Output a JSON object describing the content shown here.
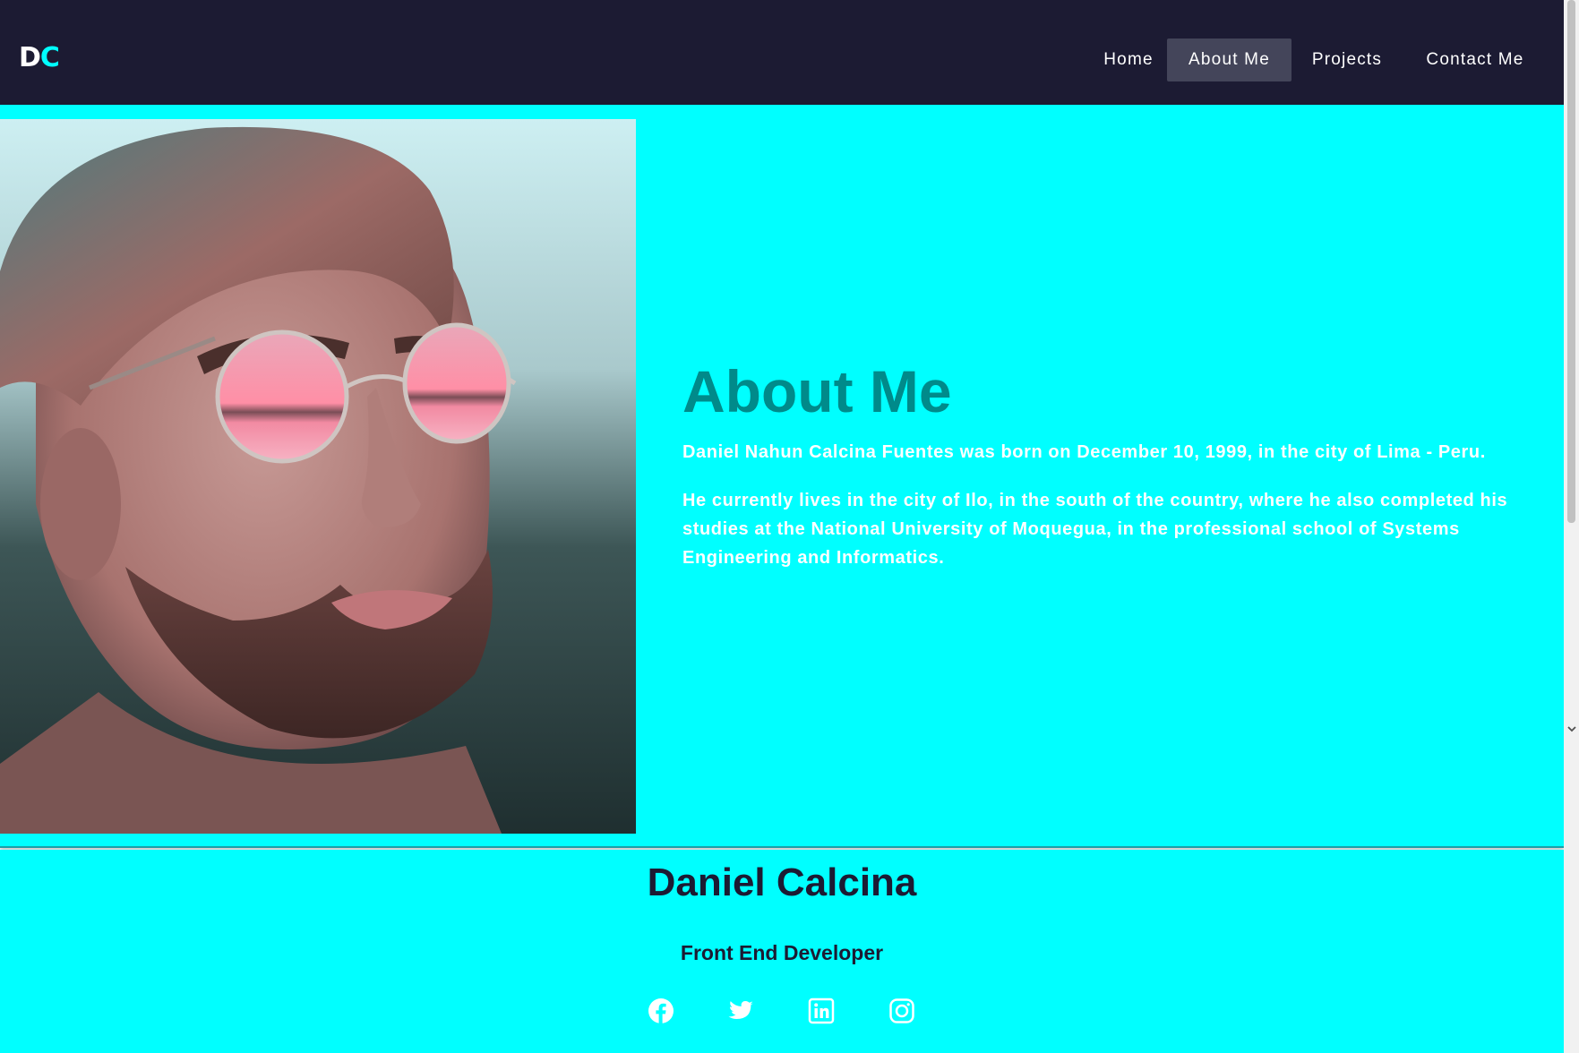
{
  "logo": {
    "part1": "D",
    "part2": "C"
  },
  "nav": {
    "items": [
      {
        "label": "Home"
      },
      {
        "label": "About Me",
        "active": true
      },
      {
        "label": "Projects"
      },
      {
        "label": "Contact Me"
      }
    ]
  },
  "hero": {
    "photo_alt": "portrait-photo",
    "title": "About Me",
    "paragraph1": "Daniel Nahun Calcina Fuentes was born on December 10, 1999, in the city of Lima - Peru.",
    "paragraph2": "He currently lives in the city of Ilo, in the south of the country, where he also completed his studies at the National University of Moquegua, in the professional school of Systems Engineering and Informatics."
  },
  "footer": {
    "name": "Daniel Calcina",
    "role": "Front End Developer",
    "socials": [
      "facebook-icon",
      "twitter-icon",
      "linkedin-icon",
      "instagram-icon"
    ]
  },
  "colors": {
    "navbar_bg": "#1c1b33",
    "accent": "#00ffff",
    "title_teal": "#008a8a",
    "active_nav_bg": "#44455a"
  }
}
